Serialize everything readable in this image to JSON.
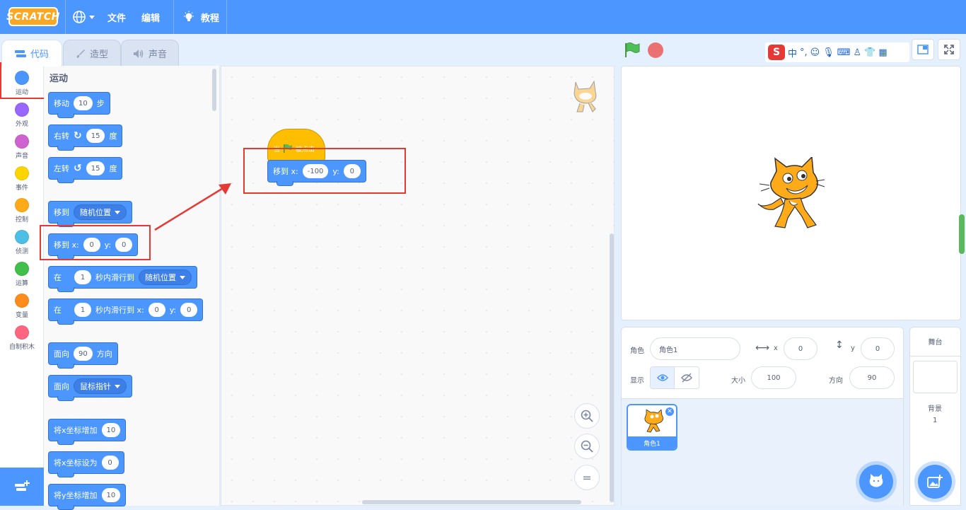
{
  "menubar": {
    "logo_text": "SCRATCH",
    "file_label": "文件",
    "edit_label": "编辑",
    "tutorial_label": "教程"
  },
  "tabs": [
    {
      "label": "代码",
      "active": true
    },
    {
      "label": "造型",
      "active": false
    },
    {
      "label": "声音",
      "active": false
    }
  ],
  "categories": [
    {
      "label": "运动",
      "color": "#4c97ff"
    },
    {
      "label": "外观",
      "color": "#9966ff"
    },
    {
      "label": "声音",
      "color": "#cf63cf"
    },
    {
      "label": "事件",
      "color": "#ffd500"
    },
    {
      "label": "控制",
      "color": "#ffab19"
    },
    {
      "label": "侦测",
      "color": "#4cbfe6"
    },
    {
      "label": "运算",
      "color": "#40bf4a"
    },
    {
      "label": "变量",
      "color": "#ff8c1a"
    },
    {
      "label": "自制积木",
      "color": "#ff6680"
    }
  ],
  "palette": {
    "title": "运动",
    "move": {
      "label": "移动",
      "steps": "10",
      "unit": "步"
    },
    "turn_right": {
      "label": "右转",
      "deg": "15",
      "unit": "度"
    },
    "turn_left": {
      "label": "左转",
      "deg": "15",
      "unit": "度"
    },
    "goto": {
      "label": "移到",
      "option": "随机位置"
    },
    "goto_xy": {
      "label": "移到 x:",
      "x": "0",
      "ylabel": "y:",
      "y": "0"
    },
    "glide": {
      "prefix": "在",
      "secs": "1",
      "mid": "秒内滑行到",
      "option": "随机位置"
    },
    "glide_xy": {
      "prefix": "在",
      "secs": "1",
      "mid": "秒内滑行到 x:",
      "x": "0",
      "ylabel": "y:",
      "y": "0"
    },
    "point_dir": {
      "label": "面向",
      "deg": "90",
      "unit": "方向"
    },
    "point_towards": {
      "label": "面向",
      "option": "鼠标指针"
    },
    "change_x": {
      "label": "将x坐标增加",
      "value": "10"
    },
    "set_x": {
      "label": "将x坐标设为",
      "value": "0"
    },
    "change_y": {
      "label": "将y坐标增加",
      "value": "10"
    }
  },
  "script": {
    "hat_prefix": "当",
    "hat_suffix": "被点击",
    "goto_label": "移到 x:",
    "x": "-100",
    "ylabel": "y:",
    "y": "0"
  },
  "sprite_info": {
    "sprite_label": "角色",
    "sprite_name": "角色1",
    "x_label": "x",
    "x": "0",
    "y_label": "y",
    "y": "0",
    "show_label": "显示",
    "size_label": "大小",
    "size": "100",
    "direction_label": "方向",
    "direction": "90"
  },
  "sprites": [
    {
      "name": "角色1"
    }
  ],
  "stage_panel": {
    "title": "舞台",
    "backdrop_label": "背景",
    "backdrop_count": "1"
  },
  "ime": {
    "lang": "中"
  },
  "zoom": {
    "reset_label": "="
  }
}
